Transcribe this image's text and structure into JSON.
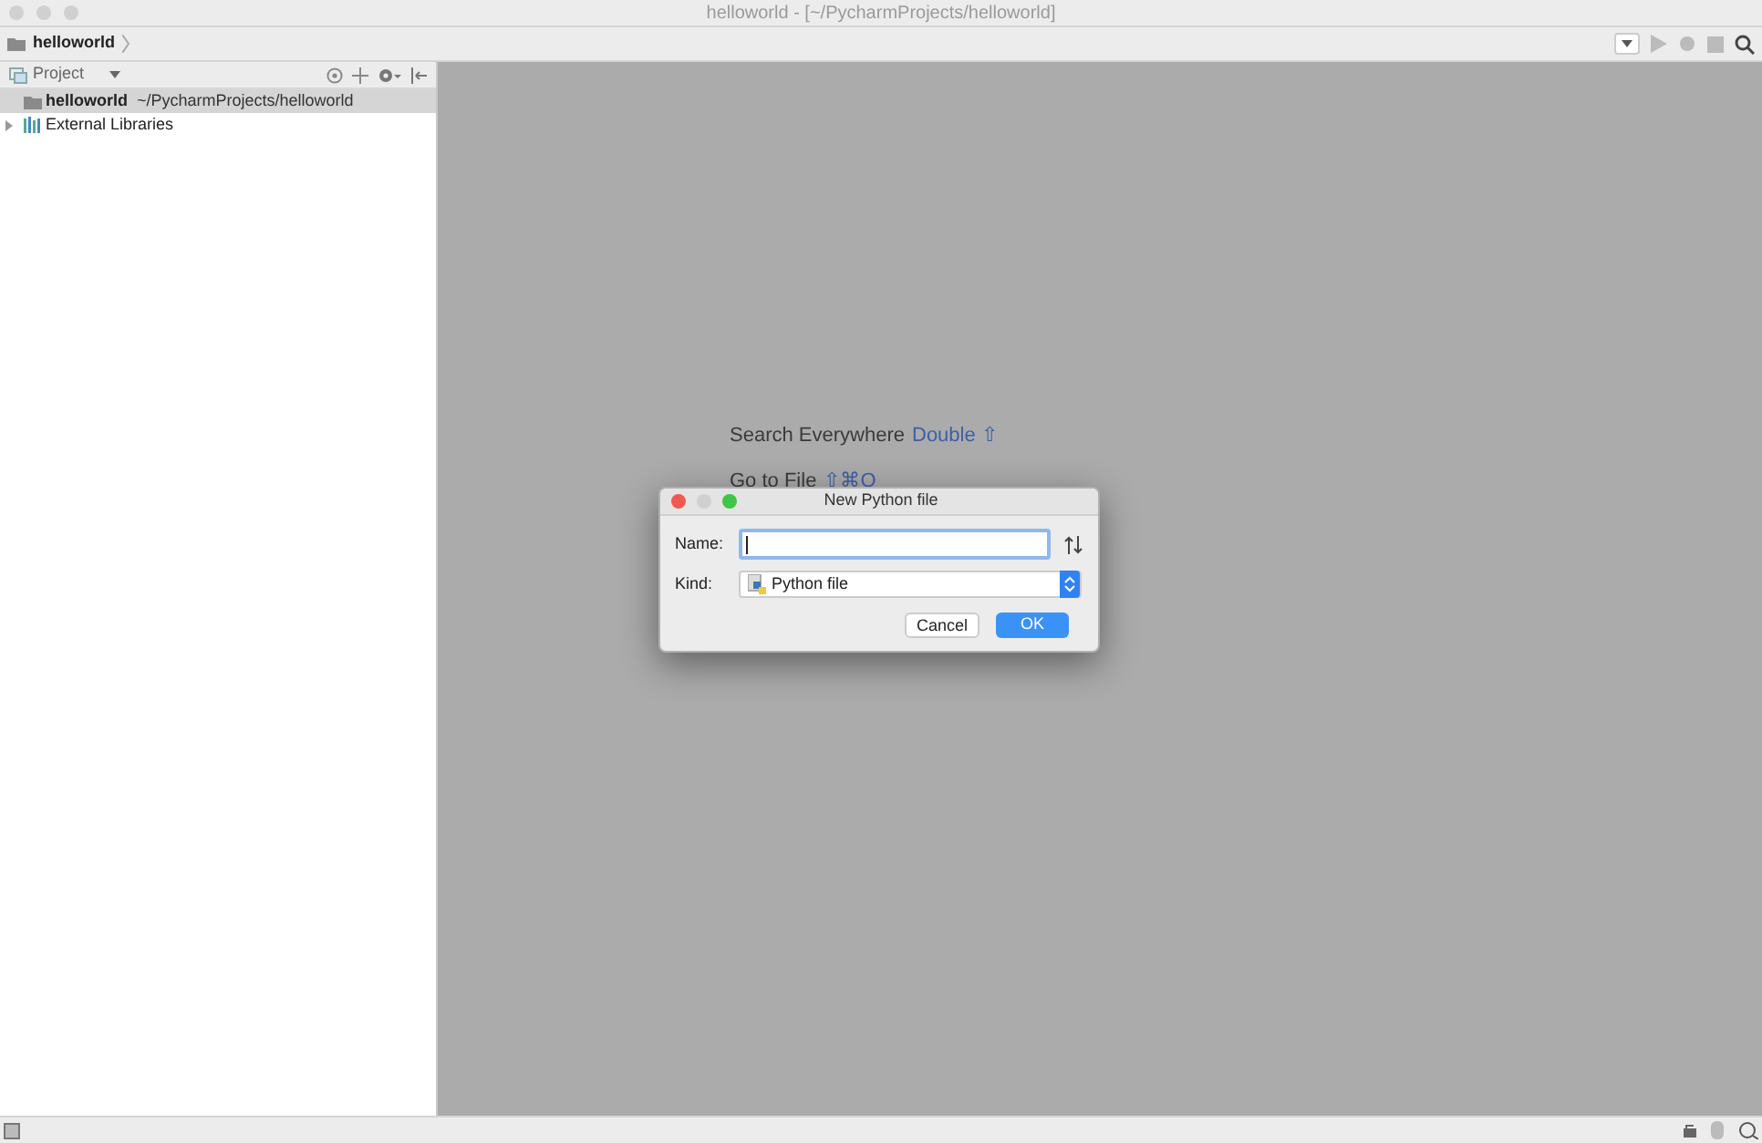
{
  "window": {
    "title": "helloworld - [~/PycharmProjects/helloworld]"
  },
  "breadcrumb": [
    "helloworld"
  ],
  "project_panel": {
    "title": "Project",
    "items": [
      {
        "label": "helloworld",
        "path": "~/PycharmProjects/helloworld",
        "selected": true,
        "kind": "folder"
      },
      {
        "label": "External Libraries",
        "selected": false,
        "expanded": false,
        "kind": "libraries"
      }
    ]
  },
  "editor_hints": [
    {
      "label": "Search Everywhere",
      "shortcut": "Double ⇧"
    },
    {
      "label": "Go to File",
      "shortcut": "⇧⌘O"
    }
  ],
  "dialog": {
    "title": "New Python file",
    "name_field": {
      "label": "Name:"
    },
    "kind_field": {
      "label": "Kind:",
      "value": "Python file"
    },
    "buttons": [
      {
        "label": "Cancel",
        "kind": "secondary"
      },
      {
        "label": "OK",
        "kind": "primary"
      }
    ]
  }
}
